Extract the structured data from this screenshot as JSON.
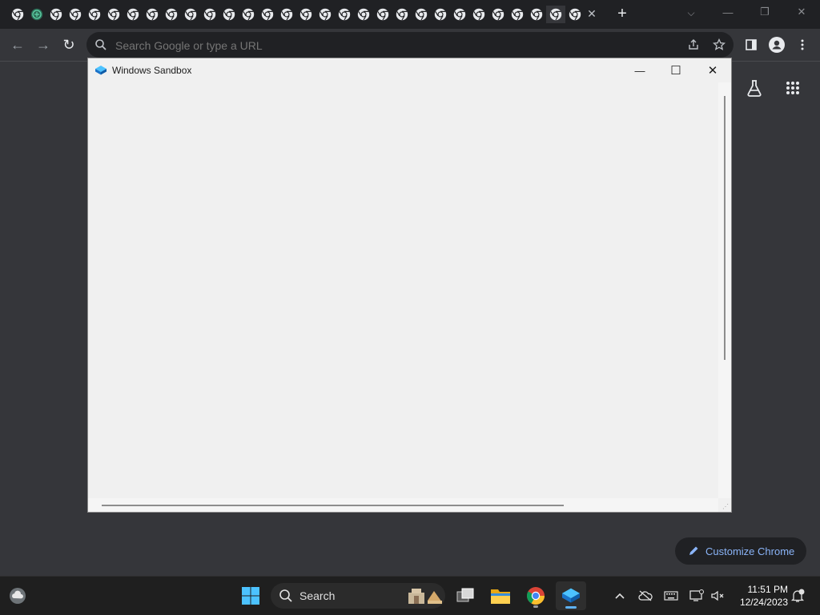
{
  "browser": {
    "tab_count": 30,
    "active_tab_index": 28,
    "tab_close_glyph": "✕",
    "new_tab_glyph": "+",
    "window_controls": [
      "⌵",
      "—",
      "❐",
      "✕"
    ]
  },
  "toolbar": {
    "back_glyph": "←",
    "forward_glyph": "→",
    "reload_glyph": "↻",
    "omnibox_placeholder": "Search Google or type a URL"
  },
  "ntp": {
    "customize_label": "Customize Chrome"
  },
  "sandbox_window": {
    "title": "Windows Sandbox",
    "minimize_glyph": "—",
    "maximize_glyph": "☐",
    "close_glyph": "✕",
    "scrollbar_thumb_fraction": 0.64
  },
  "taskbar": {
    "search_label": "Search",
    "clock_time": "11:51 PM",
    "clock_date": "12/24/2023"
  },
  "colors": {
    "chrome_dark": "#202124",
    "chrome_toolbar": "#35363a",
    "accent": "#8ab4f8",
    "sandbox_bg": "#f0f0f0",
    "taskbar": "#1f1f1f",
    "windows_blue": "#4cc2ff"
  }
}
